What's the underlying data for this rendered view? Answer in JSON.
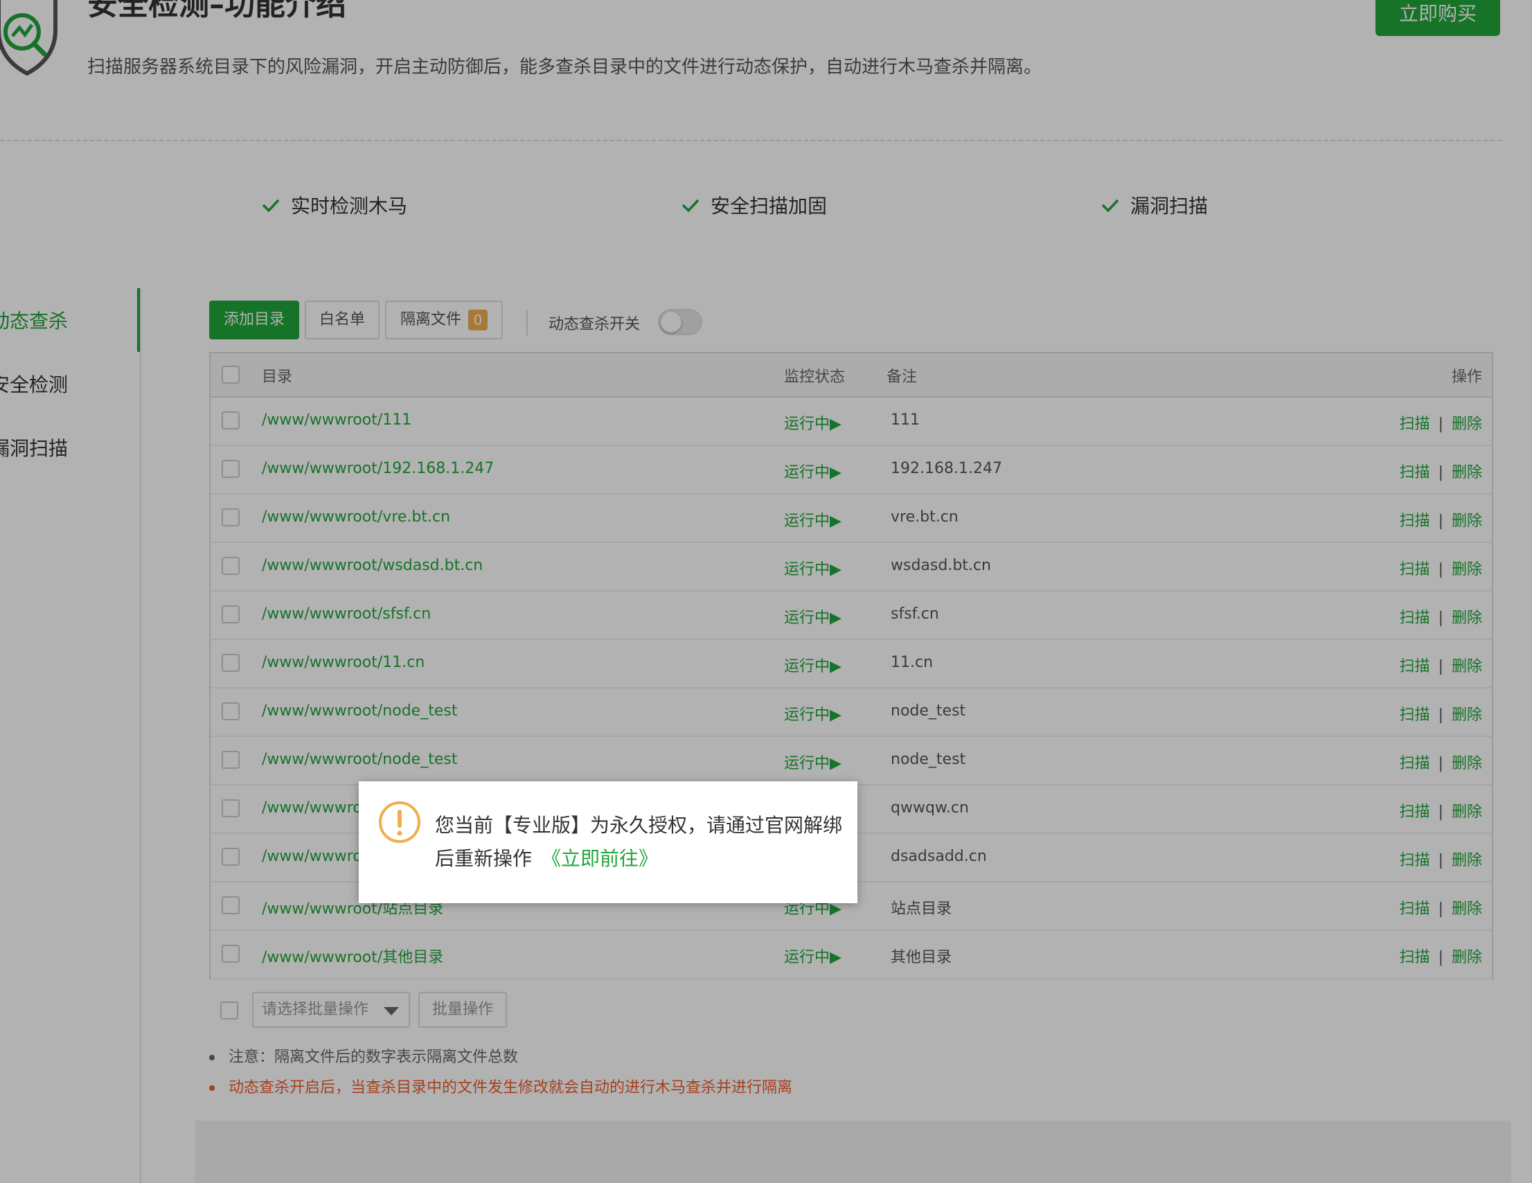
{
  "header": {
    "title": "安全检测–功能介绍",
    "description": "扫描服务器系统目录下的风险漏洞，开启主动防御后，能多查杀目录中的文件进行动态保护，自动进行木马查杀并隔离。",
    "buy_label": "立即购买"
  },
  "features": [
    "实时检测木马",
    "安全扫描加固",
    "漏洞扫描"
  ],
  "sidebar": {
    "items": [
      {
        "label": "动态查杀",
        "active": true
      },
      {
        "label": "安全检测",
        "active": false
      },
      {
        "label": "漏洞扫描",
        "active": false
      }
    ]
  },
  "toolbar": {
    "add_dir": "添加目录",
    "whitelist": "白名单",
    "quarantine": "隔离文件",
    "quarantine_count": "0",
    "switch_label": "动态查杀开关",
    "switch_on": false
  },
  "table": {
    "headers": {
      "dir": "目录",
      "status": "监控状态",
      "note": "备注",
      "ops": "操作"
    },
    "rows": [
      {
        "path": "/www/wwwroot/111",
        "status": "运行中▶",
        "note": "111"
      },
      {
        "path": "/www/wwwroot/192.168.1.247",
        "status": "运行中▶",
        "note": "192.168.1.247"
      },
      {
        "path": "/www/wwwroot/vre.bt.cn",
        "status": "运行中▶",
        "note": "vre.bt.cn"
      },
      {
        "path": "/www/wwwroot/wsdasd.bt.cn",
        "status": "运行中▶",
        "note": "wsdasd.bt.cn"
      },
      {
        "path": "/www/wwwroot/sfsf.cn",
        "status": "运行中▶",
        "note": "sfsf.cn"
      },
      {
        "path": "/www/wwwroot/11.cn",
        "status": "运行中▶",
        "note": "11.cn"
      },
      {
        "path": "/www/wwwroot/node_test",
        "status": "运行中▶",
        "note": "node_test"
      },
      {
        "path": "/www/wwwroot/node_test",
        "status": "运行中▶",
        "note": "node_test"
      },
      {
        "path": "/www/wwwro",
        "status": "",
        "note": "qwwqw.cn"
      },
      {
        "path": "/www/wwwro",
        "status": "",
        "note": "dsadsadd.cn"
      },
      {
        "path": "/www/wwwroot/站点目录",
        "status": "运行中▶",
        "note": "站点目录"
      },
      {
        "path": "/www/wwwroot/其他目录",
        "status": "运行中▶",
        "note": "其他目录"
      }
    ],
    "op_scan": "扫描",
    "op_delete": "删除",
    "op_sep": "|"
  },
  "batch": {
    "select_placeholder": "请选择批量操作",
    "button": "批量操作"
  },
  "notes": [
    "注意：隔离文件后的数字表示隔离文件总数",
    "动态查杀开启后，当查杀目录中的文件发生修改就会自动的进行木马查杀并进行隔离"
  ],
  "dialog": {
    "message": "您当前【专业版】为永久授权，请通过官网解绑后重新操作",
    "link": "《立即前往》"
  },
  "colors": {
    "accent": "#20a53a",
    "warning": "#f0ad4e",
    "danger_note": "#ef5a2b"
  }
}
